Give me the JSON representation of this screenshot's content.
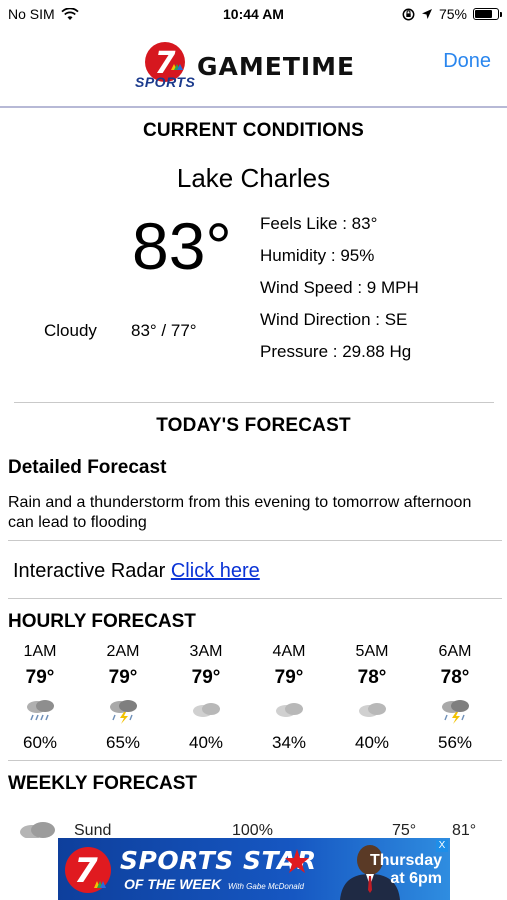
{
  "status_bar": {
    "carrier": "No SIM",
    "time": "10:44 AM",
    "battery": "75%",
    "battery_level": 0.75
  },
  "nav": {
    "logo_number": "7",
    "logo_sports": "SPORTS",
    "logo_name": "GAMETIME",
    "done_label": "Done"
  },
  "current": {
    "title": "CURRENT CONDITIONS",
    "city": "Lake Charles",
    "temperature": "83°",
    "condition": "Cloudy",
    "hi_lo": "83° / 77°",
    "details": [
      {
        "label": "Feels Like :",
        "value": "83°"
      },
      {
        "label": "Humidity :",
        "value": "95%"
      },
      {
        "label": "Wind Speed :",
        "value": "9 MPH"
      },
      {
        "label": "Wind Direction :",
        "value": "SE"
      },
      {
        "label": "Pressure :",
        "value": "29.88 Hg"
      }
    ]
  },
  "today": {
    "title": "TODAY'S FORECAST",
    "detailed_label": "Detailed Forecast",
    "detailed_text": "Rain and a thunderstorm from this evening to tomorrow afternoon can lead to flooding",
    "radar_label": "Interactive Radar",
    "radar_link": "Click here"
  },
  "hourly": {
    "title": "HOURLY FORECAST",
    "hours": [
      {
        "time": "1AM",
        "temp": "79°",
        "icon": "rain-cloud-icon",
        "pct": "60%"
      },
      {
        "time": "2AM",
        "temp": "79°",
        "icon": "thunderstorm-icon",
        "pct": "65%"
      },
      {
        "time": "3AM",
        "temp": "79°",
        "icon": "cloud-icon",
        "pct": "40%"
      },
      {
        "time": "4AM",
        "temp": "79°",
        "icon": "cloud-icon",
        "pct": "34%"
      },
      {
        "time": "5AM",
        "temp": "78°",
        "icon": "cloud-icon",
        "pct": "40%"
      },
      {
        "time": "6AM",
        "temp": "78°",
        "icon": "thunderstorm-icon",
        "pct": "56%"
      }
    ]
  },
  "weekly": {
    "title": "WEEKLY FORECAST",
    "first_row": {
      "icon": "cloud-icon",
      "day": "Sund",
      "pct": "100%",
      "hi": "75°",
      "lo": "81°"
    }
  },
  "ad": {
    "number": "7",
    "title": "SPORTS STAR",
    "subtitle": "OF THE WEEK",
    "host": "With Gabe McDonald",
    "when_day": "Thursday",
    "when_time": "at 6pm",
    "close": "X"
  },
  "colors": {
    "link": "#0a33d6",
    "done": "#2a86ee",
    "brand_red": "#d6171f",
    "brand_blue": "#1b3a8c"
  }
}
